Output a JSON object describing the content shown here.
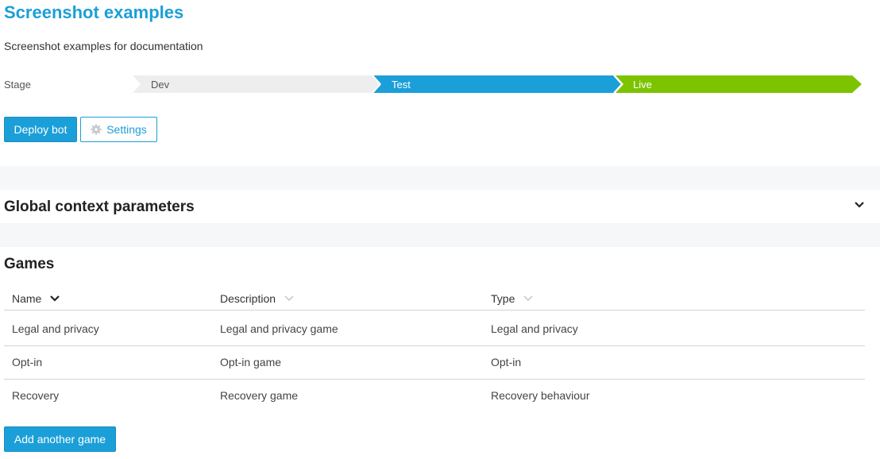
{
  "page": {
    "title": "Screenshot examples",
    "subtitle": "Screenshot examples for documentation"
  },
  "stage": {
    "label": "Stage",
    "steps": [
      {
        "label": "Dev",
        "state": "inactive",
        "color": "#eeeeee"
      },
      {
        "label": "Test",
        "state": "current",
        "color": "#1b9fd8"
      },
      {
        "label": "Live",
        "state": "active",
        "color": "#7dc300"
      }
    ]
  },
  "actions": {
    "deploy_label": "Deploy bot",
    "settings_label": "Settings",
    "settings_icon": "gear-icon"
  },
  "global_context": {
    "title": "Global context parameters",
    "toggle_icon": "chevron-down-icon"
  },
  "games": {
    "title": "Games",
    "columns": [
      {
        "label": "Name",
        "sort": "active-desc"
      },
      {
        "label": "Description",
        "sort": "inactive"
      },
      {
        "label": "Type",
        "sort": "inactive"
      }
    ],
    "rows": [
      {
        "name": "Legal and privacy",
        "description": "Legal and privacy game",
        "type": "Legal and privacy"
      },
      {
        "name": "Opt-in",
        "description": "Opt-in game",
        "type": "Opt-in"
      },
      {
        "name": "Recovery",
        "description": "Recovery game",
        "type": "Recovery behaviour"
      }
    ],
    "add_label": "Add another game"
  },
  "colors": {
    "accent": "#1b9fd8",
    "live": "#7dc300",
    "band": "#f6f7f8"
  }
}
